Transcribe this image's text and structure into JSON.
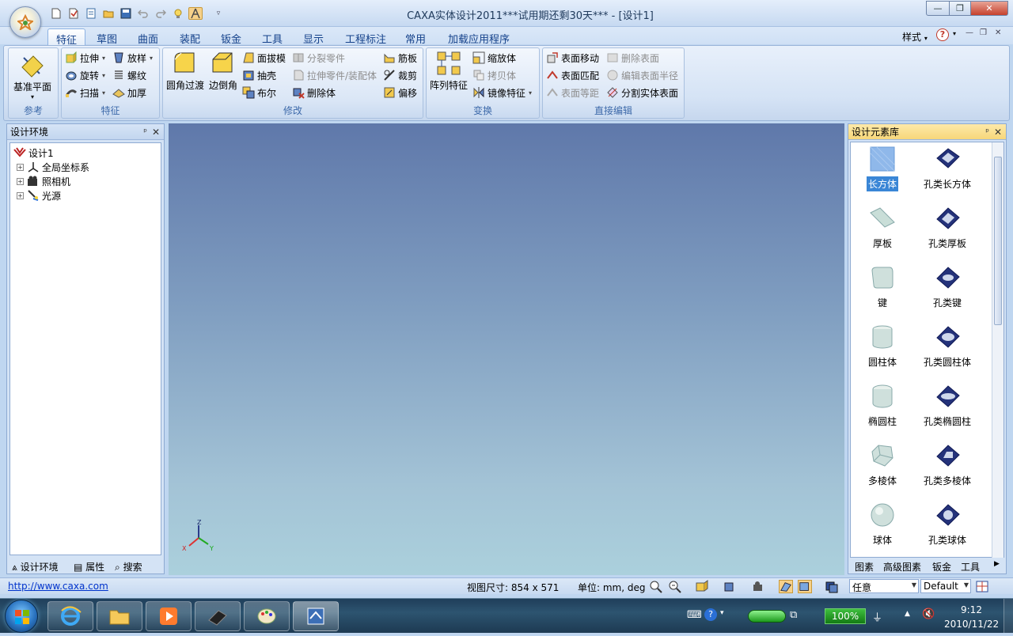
{
  "window": {
    "title": "CAXA实体设计2011***试用期还剩30天*** - [设计1]",
    "controls": {
      "minimize": "—",
      "restore": "❐",
      "close": "✕"
    },
    "inner_controls": {
      "minimize": "—",
      "restore": "❐",
      "close": "✕"
    }
  },
  "tabs": [
    "特征",
    "草图",
    "曲面",
    "装配",
    "钣金",
    "工具",
    "显示",
    "工程标注",
    "常用",
    "加载应用程序"
  ],
  "tabs_right": {
    "style": "样式",
    "dd": "▾",
    "help": "?"
  },
  "ribbon": {
    "reference": {
      "label": "参考",
      "base_plane": "基准平面"
    },
    "feature": {
      "label": "特征",
      "extrude": "拉伸",
      "revolve": "旋转",
      "sweep": "扫描",
      "loft": "放样",
      "thread": "螺纹",
      "thicken": "加厚"
    },
    "modify": {
      "label": "修改",
      "fillet": "圆角过渡",
      "chamfer": "边倒角",
      "draft": "面拔模",
      "shell": "抽壳",
      "boolean": "布尔",
      "split_part": "分裂零件",
      "extrude_part": "拉伸零件/装配体",
      "delete_body": "删除体",
      "rib": "筋板",
      "trim": "裁剪",
      "offset": "偏移"
    },
    "transform": {
      "label": "变换",
      "pattern": "阵列特征",
      "scale": "缩放体",
      "copy": "拷贝体",
      "mirror": "镜像特征"
    },
    "direct_edit": {
      "label": "直接编辑",
      "move_face": "表面移动",
      "match_face": "表面匹配",
      "offset_face": "表面等距",
      "delete_face": "删除表面",
      "edit_radius": "编辑表面半径",
      "split_face": "分割实体表面"
    }
  },
  "left_panel": {
    "title": "设计环境",
    "pin": "ᵖ",
    "close": "✕",
    "tree": [
      {
        "label": "设计1",
        "icon": "design-icon"
      },
      {
        "label": "全局坐标系",
        "icon": "coordinate-icon"
      },
      {
        "label": "照相机",
        "icon": "camera-icon"
      },
      {
        "label": "光源",
        "icon": "light-icon"
      }
    ],
    "bottom_tabs": [
      "设计环境",
      "属性",
      "搜索"
    ]
  },
  "right_panel": {
    "title": "设计元素库",
    "pin": "ᵖ",
    "close": "✕",
    "items": [
      {
        "label": "长方体",
        "icon": "cuboid-icon",
        "selected": true
      },
      {
        "label": "孔类长方体",
        "icon": "hole-cuboid-icon"
      },
      {
        "label": "厚板",
        "icon": "plate-icon"
      },
      {
        "label": "孔类厚板",
        "icon": "hole-plate-icon"
      },
      {
        "label": "键",
        "icon": "key-icon"
      },
      {
        "label": "孔类键",
        "icon": "hole-key-icon"
      },
      {
        "label": "圆柱体",
        "icon": "cylinder-icon"
      },
      {
        "label": "孔类圆柱体",
        "icon": "hole-cylinder-icon"
      },
      {
        "label": "椭圆柱",
        "icon": "elliptic-cylinder-icon"
      },
      {
        "label": "孔类椭圆柱",
        "icon": "hole-elliptic-cylinder-icon"
      },
      {
        "label": "多棱体",
        "icon": "prism-icon"
      },
      {
        "label": "孔类多棱体",
        "icon": "hole-prism-icon"
      },
      {
        "label": "球体",
        "icon": "sphere-icon"
      },
      {
        "label": "孔类球体",
        "icon": "hole-sphere-icon"
      }
    ],
    "bottom_tabs": [
      "图素",
      "高级图素",
      "钣金",
      "工具"
    ]
  },
  "axes": {
    "z": "Z",
    "x": "X",
    "y": "Y"
  },
  "status": {
    "url": "http://www.caxa.com",
    "view_size": "视图尺寸:  854 x 571",
    "units": "单位: mm, deg",
    "combo1": "任意",
    "combo2": "Default"
  },
  "taskbar": {
    "battery": "100%",
    "time": "9:12",
    "date": "2010/11/22"
  },
  "colors": {
    "accent": "#15428b",
    "viewport_top": "#5f78aa",
    "viewport_bottom": "#abd0dc",
    "selection": "#3a86d6"
  }
}
